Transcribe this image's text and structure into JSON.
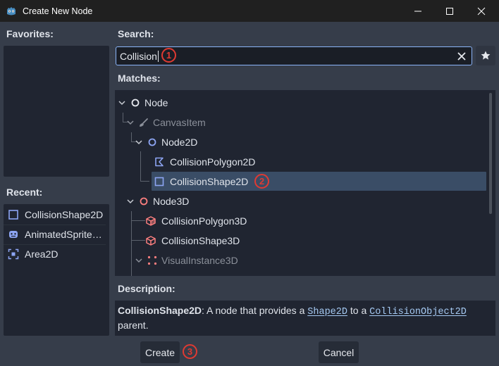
{
  "window": {
    "title": "Create New Node"
  },
  "favorites": {
    "label": "Favorites:"
  },
  "recent": {
    "label": "Recent:",
    "items": [
      {
        "label": "CollisionShape2D",
        "icon": "collision-shape-2d-icon"
      },
      {
        "label": "AnimatedSprite…",
        "icon": "animated-sprite-icon"
      },
      {
        "label": "Area2D",
        "icon": "area2d-icon"
      }
    ]
  },
  "search": {
    "label": "Search:",
    "value": "Collision"
  },
  "matches": {
    "label": "Matches:",
    "items": [
      {
        "label": "Node",
        "icon": "node-icon",
        "dim": false
      },
      {
        "label": "CanvasItem",
        "icon": "canvas-item-icon",
        "dim": true
      },
      {
        "label": "Node2D",
        "icon": "node2d-icon",
        "dim": false
      },
      {
        "label": "CollisionPolygon2D",
        "icon": "collision-polygon-2d-icon",
        "dim": false
      },
      {
        "label": "CollisionShape2D",
        "icon": "collision-shape-2d-icon",
        "dim": false,
        "selected": true
      },
      {
        "label": "Node3D",
        "icon": "node3d-icon",
        "dim": false
      },
      {
        "label": "CollisionPolygon3D",
        "icon": "collision-polygon-3d-icon",
        "dim": false
      },
      {
        "label": "CollisionShape3D",
        "icon": "collision-shape-3d-icon",
        "dim": false
      },
      {
        "label": "VisualInstance3D",
        "icon": "visual-instance-3d-icon",
        "dim": true
      }
    ]
  },
  "description": {
    "label": "Description:",
    "name": "CollisionShape2D",
    "text_a": ": A node that provides a ",
    "link1": "Shape2D",
    "text_b": " to a ",
    "link2": "CollisionObject2D",
    "text_c": "parent."
  },
  "buttons": {
    "create": "Create",
    "cancel": "Cancel"
  },
  "markers": {
    "m1": "1",
    "m2": "2",
    "m3": "3"
  },
  "colors": {
    "accent": "#8ab4f8",
    "selection": "#3a4d66",
    "marker": "#e03a32",
    "node2d": "#8da5f3",
    "node3d": "#fc7f7f"
  }
}
